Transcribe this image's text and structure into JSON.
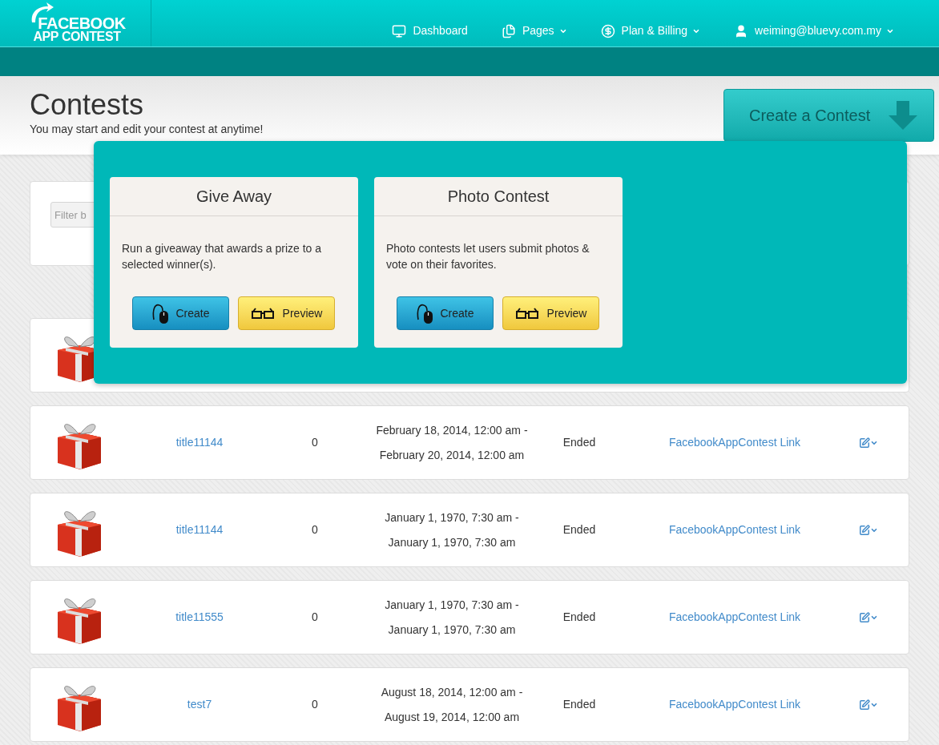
{
  "logo": {
    "line1": "FACEBOOK",
    "line2": "APP CONTEST"
  },
  "nav": [
    {
      "label": "Dashboard",
      "dropdown": false
    },
    {
      "label": "Pages",
      "dropdown": true
    },
    {
      "label": "Plan & Billing",
      "dropdown": true
    },
    {
      "label": "weiming@bluevy.com.my",
      "dropdown": true
    }
  ],
  "page_header": {
    "title": "Contests",
    "subtitle": "You may start and edit your contest at anytime!",
    "create_button": "Create a Contest"
  },
  "filter": {
    "placeholder": "Filter b"
  },
  "create_menu": {
    "options": [
      {
        "title": "Give Away",
        "description": "Run a giveaway that awards a prize to a selected winner(s).",
        "create": "Create",
        "preview": "Preview"
      },
      {
        "title": "Photo Contest",
        "description": "Photo contests let users submit photos & vote on their favorites.",
        "create": "Create",
        "preview": "Preview"
      }
    ]
  },
  "contests": [
    {
      "title": "title11144",
      "count": "0",
      "start": "February 18, 2014, 12:00 am -",
      "end": "February 20, 2014, 12:00 am",
      "status": "Ended",
      "link": "FacebookAppContest Link"
    },
    {
      "title": "title11144",
      "count": "0",
      "start": "January 1, 1970, 7:30 am -",
      "end": "January 1, 1970, 7:30 am",
      "status": "Ended",
      "link": "FacebookAppContest Link"
    },
    {
      "title": "title11555",
      "count": "0",
      "start": "January 1, 1970, 7:30 am -",
      "end": "January 1, 1970, 7:30 am",
      "status": "Ended",
      "link": "FacebookAppContest Link"
    },
    {
      "title": "test7",
      "count": "0",
      "start": "August 18, 2014, 12:00 am -",
      "end": "August 19, 2014, 12:00 am",
      "status": "Ended",
      "link": "FacebookAppContest Link"
    }
  ]
}
